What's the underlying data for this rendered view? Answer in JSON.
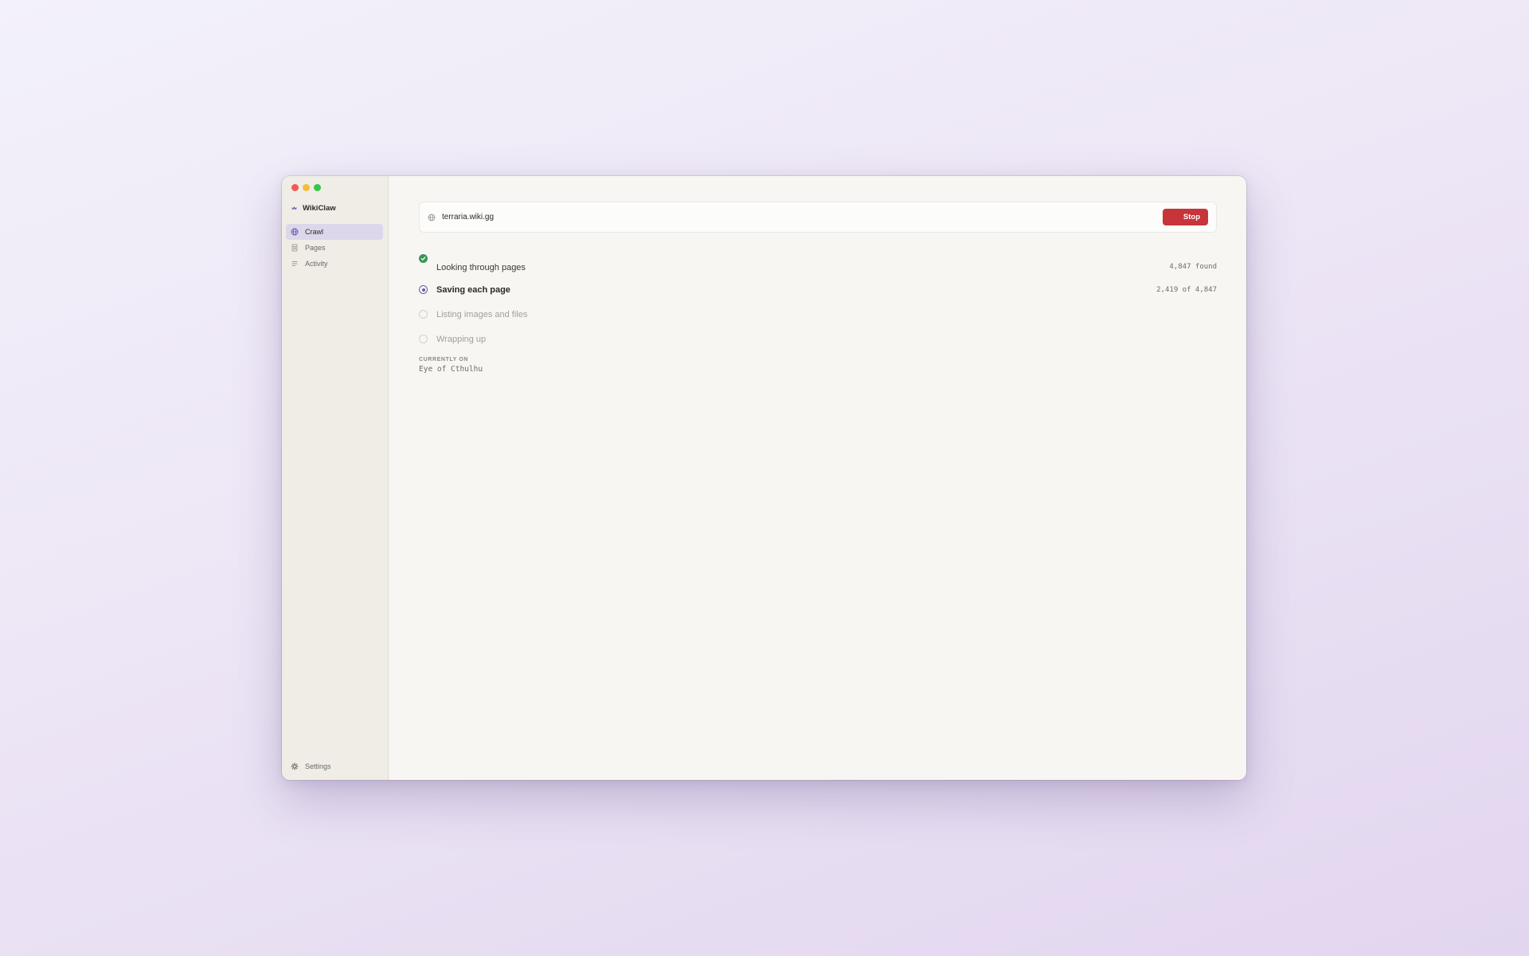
{
  "app": {
    "name": "WikiClaw",
    "colors": {
      "accent": "#6c5bb5",
      "stop": "#c7343a",
      "success": "#3f9456",
      "traffic_close": "#ee5d55",
      "traffic_min": "#f3bd3b",
      "traffic_max": "#35c64a"
    }
  },
  "sidebar": {
    "items": [
      {
        "label": "Crawl",
        "icon": "globe-icon",
        "active": true
      },
      {
        "label": "Pages",
        "icon": "document-icon",
        "active": false
      },
      {
        "label": "Activity",
        "icon": "list-icon",
        "active": false
      }
    ],
    "settings_label": "Settings",
    "settings_icon": "gear-icon"
  },
  "crawl": {
    "url": "terraria.wiki.gg",
    "stop_label": "Stop",
    "steps": [
      {
        "label": "Looking through pages",
        "status": "done",
        "count": "4,847 found"
      },
      {
        "label": "Saving each page",
        "status": "active",
        "count": "2,419 of 4,847"
      },
      {
        "label": "Listing images and files",
        "status": "pending",
        "count": ""
      },
      {
        "label": "Wrapping up",
        "status": "pending",
        "count": ""
      }
    ],
    "current_label": "CURRENTLY ON",
    "current_value": "Eye of Cthulhu"
  }
}
